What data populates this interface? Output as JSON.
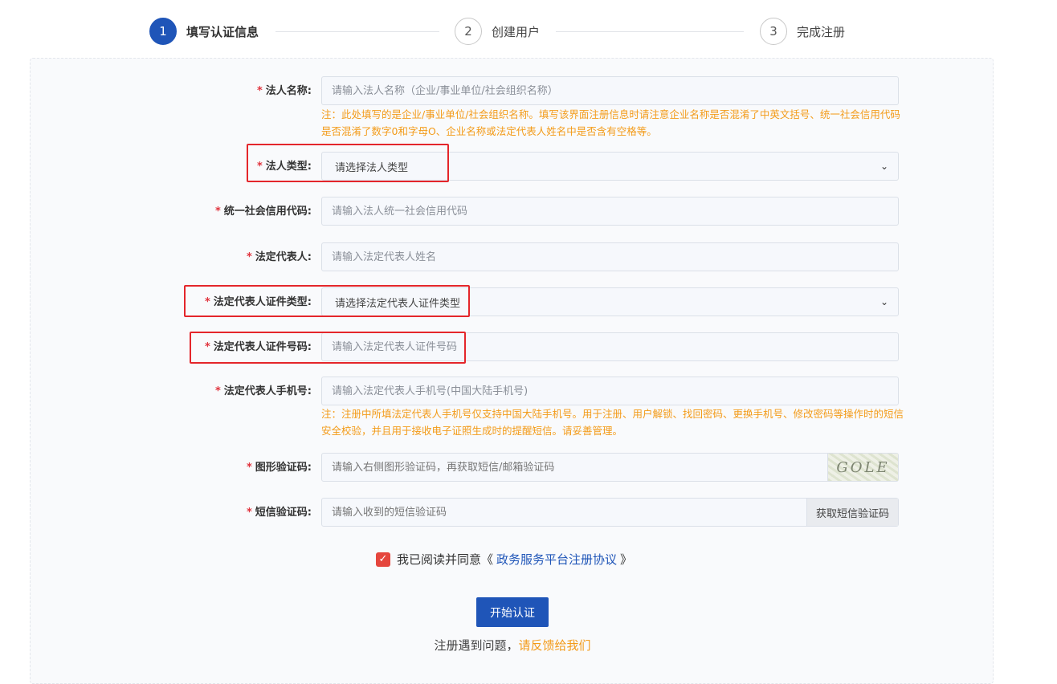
{
  "steps": [
    {
      "num": "1",
      "label": "填写认证信息",
      "active": true
    },
    {
      "num": "2",
      "label": "创建用户",
      "active": false
    },
    {
      "num": "3",
      "label": "完成注册",
      "active": false
    }
  ],
  "form": {
    "required_mark": "*",
    "legal_name": {
      "label": "法人名称:",
      "placeholder": "请输入法人名称（企业/事业单位/社会组织名称）",
      "note": "注：此处填写的是企业/事业单位/社会组织名称。填写该界面注册信息时请注意企业名称是否混淆了中英文括号、统一社会信用代码是否混淆了数字0和字母O、企业名称或法定代表人姓名中是否含有空格等。"
    },
    "legal_type": {
      "label": "法人类型:",
      "value": "请选择法人类型"
    },
    "credit_code": {
      "label": "统一社会信用代码:",
      "placeholder": "请输入法人统一社会信用代码"
    },
    "legal_rep": {
      "label": "法定代表人:",
      "placeholder": "请输入法定代表人姓名"
    },
    "rep_id_type": {
      "label": "法定代表人证件类型:",
      "value": "请选择法定代表人证件类型"
    },
    "rep_id_number": {
      "label": "法定代表人证件号码:",
      "placeholder": "请输入法定代表人证件号码"
    },
    "rep_phone": {
      "label": "法定代表人手机号:",
      "placeholder": "请输入法定代表人手机号(中国大陆手机号)",
      "note": "注：注册中所填法定代表人手机号仅支持中国大陆手机号。用于注册、用户解锁、找回密码、更换手机号、修改密码等操作时的短信安全校验，并且用于接收电子证照生成时的提醒短信。请妥善管理。"
    },
    "captcha": {
      "label": "图形验证码:",
      "placeholder": "请输入右侧图形验证码，再获取短信/邮箱验证码",
      "image_text": "GOLE"
    },
    "sms_code": {
      "label": "短信验证码:",
      "placeholder": "请输入收到的短信验证码",
      "button": "获取短信验证码"
    }
  },
  "agreement": {
    "checked": true,
    "prefix": "我已阅读并同意《",
    "link": "政务服务平台注册协议",
    "suffix": "》"
  },
  "submit_label": "开始认证",
  "footer": {
    "question": "注册遇到问题，",
    "feedback_link": "请反馈给我们"
  },
  "colors": {
    "primary": "#1f55b8",
    "note": "#f39b19",
    "required": "#e0323c",
    "highlight": "#e4262b"
  }
}
